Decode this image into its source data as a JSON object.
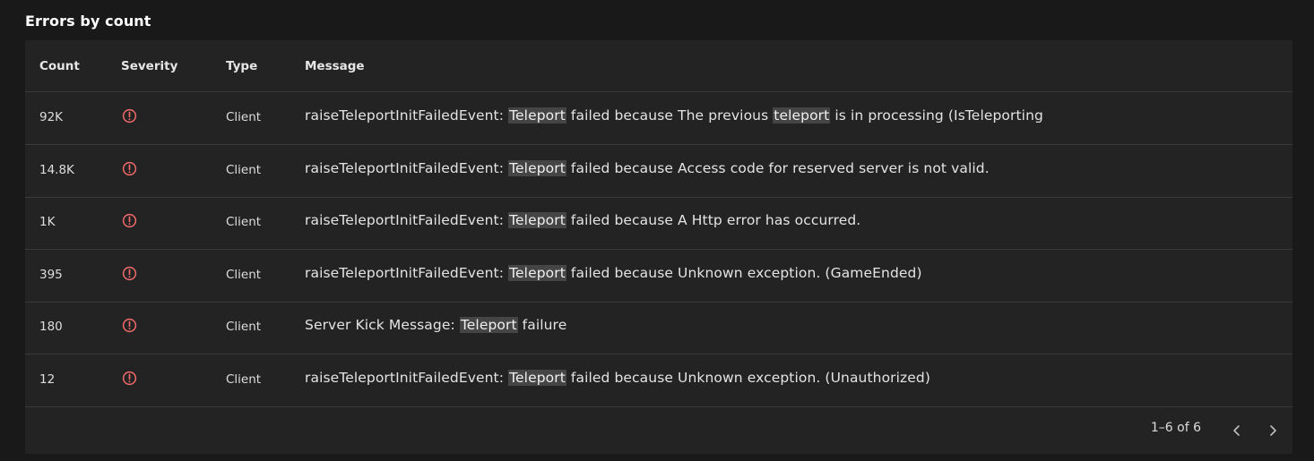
{
  "section": {
    "title": "Errors by count"
  },
  "table": {
    "columns": {
      "count": "Count",
      "severity": "Severity",
      "type": "Type",
      "message": "Message"
    },
    "rows": [
      {
        "count": "92K",
        "severity": "error-icon",
        "type": "Client",
        "message_parts": [
          {
            "text": "raiseTeleportInitFailedEvent: ",
            "hl": false
          },
          {
            "text": "Teleport",
            "hl": true
          },
          {
            "text": " failed because The previous ",
            "hl": false
          },
          {
            "text": "teleport",
            "hl": true
          },
          {
            "text": " is in processing (IsTeleporting",
            "hl": false
          }
        ]
      },
      {
        "count": "14.8K",
        "severity": "error-icon",
        "type": "Client",
        "message_parts": [
          {
            "text": "raiseTeleportInitFailedEvent: ",
            "hl": false
          },
          {
            "text": "Teleport",
            "hl": true
          },
          {
            "text": " failed because Access code for reserved server is not valid.",
            "hl": false
          }
        ]
      },
      {
        "count": "1K",
        "severity": "error-icon",
        "type": "Client",
        "message_parts": [
          {
            "text": "raiseTeleportInitFailedEvent: ",
            "hl": false
          },
          {
            "text": "Teleport",
            "hl": true
          },
          {
            "text": " failed because A Http error has occurred.",
            "hl": false
          }
        ]
      },
      {
        "count": "395",
        "severity": "error-icon",
        "type": "Client",
        "message_parts": [
          {
            "text": "raiseTeleportInitFailedEvent: ",
            "hl": false
          },
          {
            "text": "Teleport",
            "hl": true
          },
          {
            "text": " failed because Unknown exception. (GameEnded)",
            "hl": false
          }
        ]
      },
      {
        "count": "180",
        "severity": "error-icon",
        "type": "Client",
        "message_parts": [
          {
            "text": "Server Kick Message: ",
            "hl": false
          },
          {
            "text": "Teleport",
            "hl": true
          },
          {
            "text": " failure",
            "hl": false
          }
        ]
      },
      {
        "count": "12",
        "severity": "error-icon",
        "type": "Client",
        "message_parts": [
          {
            "text": "raiseTeleportInitFailedEvent: ",
            "hl": false
          },
          {
            "text": "Teleport",
            "hl": true
          },
          {
            "text": " failed because Unknown exception. (Unauthorized)",
            "hl": false
          }
        ]
      }
    ]
  },
  "pagination": {
    "range_text": "1–6 of 6",
    "prev_icon": "chevron-left-icon",
    "next_icon": "chevron-right-icon"
  },
  "colors": {
    "error": "#f06a6a",
    "highlight": "#454545",
    "panel": "#232323",
    "background": "#191919"
  }
}
